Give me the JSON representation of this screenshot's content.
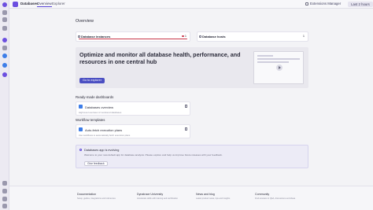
{
  "app": {
    "name": "Databases"
  },
  "tabs": [
    {
      "label": "Overview"
    },
    {
      "label": "Explorer"
    }
  ],
  "header": {
    "extensions_label": "Extensions Manager",
    "timeframe_label": "Last 2 hours"
  },
  "page": {
    "title": "Overview"
  },
  "kpis": [
    {
      "label": "Database instances",
      "value": "1",
      "status_color": "#c8364a"
    },
    {
      "label": "Database hosts",
      "value": "1"
    }
  ],
  "hero": {
    "title": "Optimize and monitor all database health, performance, and resources in one central hub",
    "button": "Go to explorer"
  },
  "ready_made": {
    "heading": "Ready-made dashboards",
    "items": [
      {
        "name": "Databases overview",
        "desc": "High-level overview of monitored databases"
      }
    ]
  },
  "workflows": {
    "heading": "Workflow templates",
    "items": [
      {
        "name": "Auto-fetch execution plans",
        "desc": "Use workflows to automatically fetch execution plans"
      }
    ]
  },
  "info": {
    "title": "Databases app is evolving",
    "body": "Welcome to your new default app for database analysis. Please explore and help us improve future releases with your feedback.",
    "button": "Give feedback"
  },
  "footer": [
    {
      "heading": "Documentation",
      "text": "Setup, guides, integrations and references"
    },
    {
      "heading": "Dynatrace University",
      "text": "Accelerate skills with training and certification"
    },
    {
      "heading": "News and blog",
      "text": "Latest product news, tips and insights"
    },
    {
      "heading": "Community",
      "text": "Find answers in Q&A, discussions and ideas"
    }
  ]
}
